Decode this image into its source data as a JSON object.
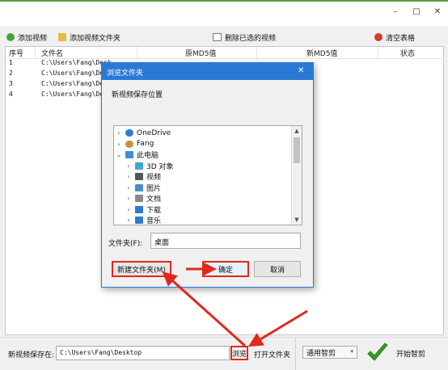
{
  "window": {
    "minimize_glyph": "–",
    "maximize_glyph": "□",
    "close_glyph": "✕"
  },
  "toolbar": {
    "add_video": "添加视频",
    "add_folder": "添加视频文件夹",
    "delete_cut": "删除已选的视频",
    "clear_table": "清空表格"
  },
  "table": {
    "headers": [
      "序号",
      "文件名",
      "原MD5值",
      "新MD5值",
      "状态"
    ],
    "rows": [
      {
        "index": "1",
        "file": "C:\\Users\\Fang\\Desk",
        "orig": "",
        "new": "",
        "status": ""
      },
      {
        "index": "2",
        "file": "C:\\Users\\Fang\\Desk",
        "orig": "",
        "new": "",
        "status": ""
      },
      {
        "index": "3",
        "file": "C:\\Users\\Fang\\Desk",
        "orig": "",
        "new": "",
        "status": ""
      },
      {
        "index": "4",
        "file": "C:\\Users\\Fang\\Desk",
        "orig": "",
        "new": "",
        "status": ""
      }
    ]
  },
  "dialog": {
    "title": "浏览文件夹",
    "close_glyph": "✕",
    "prompt": "新视频保存位置",
    "tree": [
      {
        "label": "OneDrive",
        "icon": "cloud-icon",
        "level": 0,
        "color": "#2b7cd3"
      },
      {
        "label": "Fang",
        "icon": "user-icon",
        "level": 0,
        "color": "#c98f3c"
      },
      {
        "label": "此电脑",
        "icon": "computer-icon",
        "level": 0,
        "color": "#3b8fd9"
      },
      {
        "label": "3D 对象",
        "icon": "cube-icon",
        "level": 1,
        "color": "#38a8d8"
      },
      {
        "label": "视频",
        "icon": "video-icon",
        "level": 1,
        "color": "#555555"
      },
      {
        "label": "图片",
        "icon": "picture-icon",
        "level": 1,
        "color": "#4a90c8"
      },
      {
        "label": "文档",
        "icon": "document-icon",
        "level": 1,
        "color": "#8a8a8a"
      },
      {
        "label": "下载",
        "icon": "download-icon",
        "level": 1,
        "color": "#2b7cd3"
      },
      {
        "label": "音乐",
        "icon": "music-icon",
        "level": 1,
        "color": "#2b7cd3"
      }
    ],
    "folder_label": "文件夹(F):",
    "folder_value": "桌面",
    "new_folder_button": "新建文件夹(M)",
    "ok_button": "确定",
    "cancel_button": "取消"
  },
  "bottom": {
    "save_label": "新视频保存在:",
    "save_path": "C:\\Users\\Fang\\Desktop",
    "browse_button": "浏览",
    "open_folder_button": "打开文件夹",
    "mode_select": "通用智剪",
    "start_button": "开始智剪"
  },
  "colors": {
    "accent_green": "#5a9e3b",
    "dialog_blue": "#2b79d6",
    "annotation_red": "#e0281c"
  }
}
